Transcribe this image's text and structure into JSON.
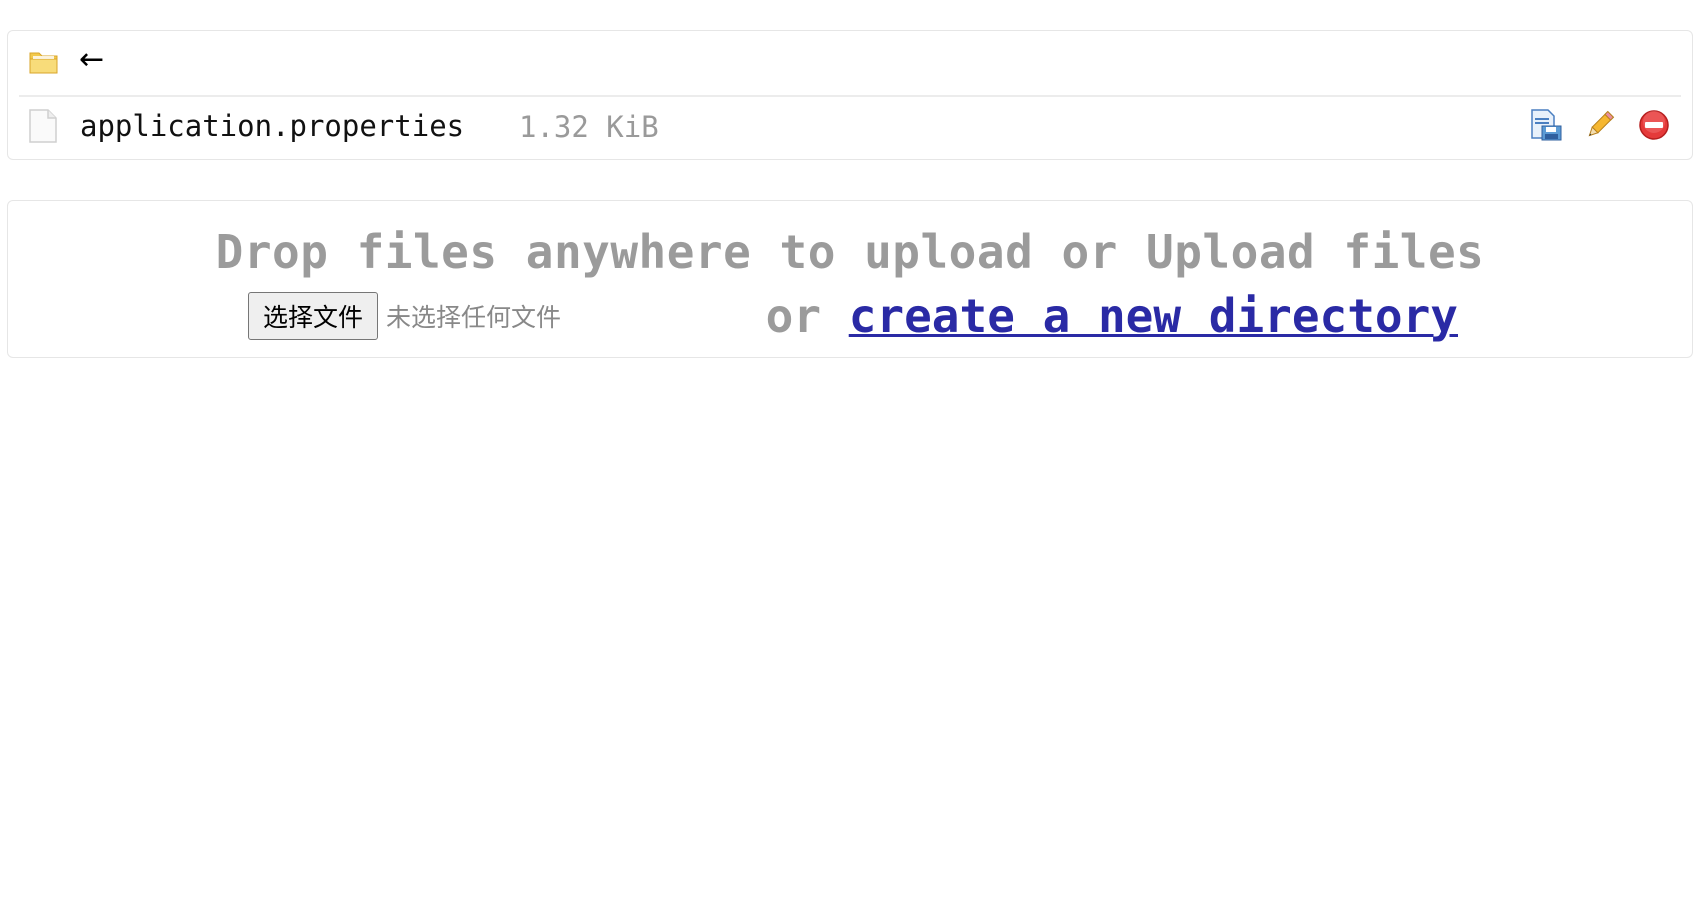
{
  "listing": {
    "parent_row": {
      "icon": "folder-icon",
      "back_label": "←"
    },
    "files": [
      {
        "icon": "file-icon",
        "name": "application.properties",
        "size": "1.32 KiB",
        "actions": [
          "download-icon",
          "edit-icon",
          "delete-icon"
        ]
      }
    ]
  },
  "upload": {
    "drop_text": "Drop files anywhere to upload or Upload files",
    "choose_button": "选择文件",
    "no_file_text": "未选择任何文件",
    "or_text": "or",
    "create_link": "create a new directory"
  },
  "colors": {
    "link": "#2a2aa5",
    "muted_text": "#9b9b9b",
    "border": "#e6e6e6",
    "delete": "#e53a3a",
    "folder": "#f2c94c"
  }
}
